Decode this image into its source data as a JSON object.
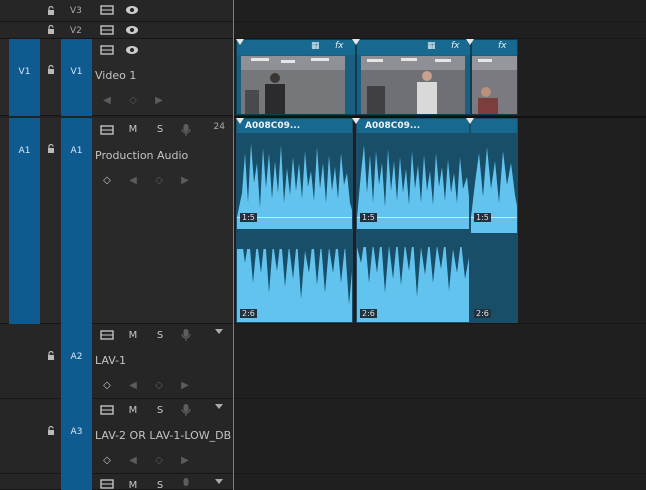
{
  "tracks": {
    "v3": {
      "label": "V3"
    },
    "v2": {
      "label": "V2"
    },
    "v1": {
      "target": "V1",
      "patch": "V1",
      "name": "Video 1"
    },
    "a1": {
      "target": "A1",
      "patch": "A1",
      "name": "Production Audio",
      "channels": "24",
      "mute": "M",
      "solo": "S"
    },
    "a2": {
      "patch": "A2",
      "name": "LAV-1",
      "mute": "M",
      "solo": "S"
    },
    "a3": {
      "patch": "A3",
      "name": "LAV-2 OR LAV-1-LOW_DB",
      "mute": "M",
      "solo": "S"
    },
    "a4": {
      "mute": "M",
      "solo": "S"
    }
  },
  "audio_clips": [
    {
      "name": "A008C09...",
      "ch1": "1:5",
      "ch2": "2:6"
    },
    {
      "name": "A008C09...",
      "ch1": "1:5",
      "ch2": "2:6"
    },
    {
      "name": "",
      "ch1": "1:5",
      "ch2": "2:6"
    }
  ],
  "video_clips": [
    {
      "fx": "fx"
    },
    {
      "fx": "fx"
    },
    {
      "fx": "fx"
    }
  ],
  "icons": {
    "lock": "lock-icon",
    "eye": "eye-icon",
    "sync": "sync-lock-icon",
    "mic": "mic-icon",
    "keyframe": "keyframe-icon"
  },
  "colors": {
    "track_target": "#0f5a8e",
    "audio_clip": "#62c3ee",
    "clip_header": "#17698f",
    "playhead": "#3b8fd6"
  }
}
